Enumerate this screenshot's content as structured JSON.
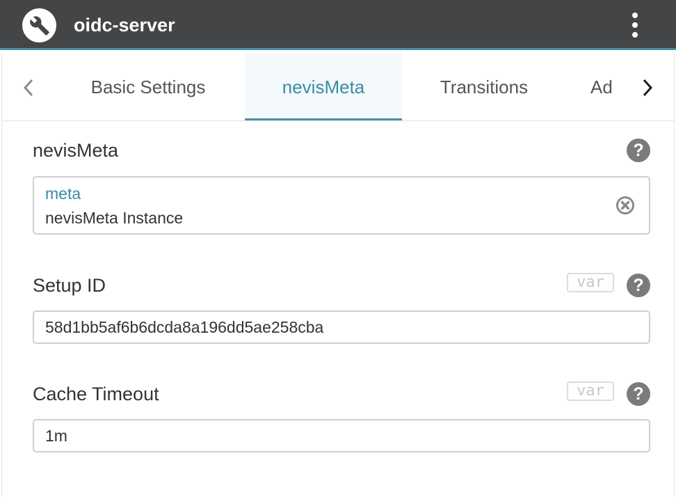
{
  "header": {
    "title": "oidc-server",
    "app_icon": "wrench-icon",
    "menu_icon": "more-vertical-icon",
    "background_color": "#444547",
    "accent_color": "#4a90a8"
  },
  "tabs": {
    "prev_icon": "chevron-left-icon",
    "next_icon": "chevron-right-icon",
    "items": [
      {
        "label": "Basic Settings",
        "active": false
      },
      {
        "label": "nevisMeta",
        "active": true
      },
      {
        "label": "Transitions",
        "active": false
      },
      {
        "label": "Ad",
        "active": false
      }
    ]
  },
  "fields": {
    "nevis_meta": {
      "label": "nevisMeta",
      "reference_type": "meta",
      "reference_name": "nevisMeta Instance",
      "clear_icon": "clear-circle-icon",
      "help_icon": "help-icon"
    },
    "setup_id": {
      "label": "Setup ID",
      "var_label": "var",
      "value": "58d1bb5af6b6dcda8a196dd5ae258cba",
      "help_icon": "help-icon"
    },
    "cache_timeout": {
      "label": "Cache Timeout",
      "var_label": "var",
      "value": "1m",
      "help_icon": "help-icon"
    }
  }
}
